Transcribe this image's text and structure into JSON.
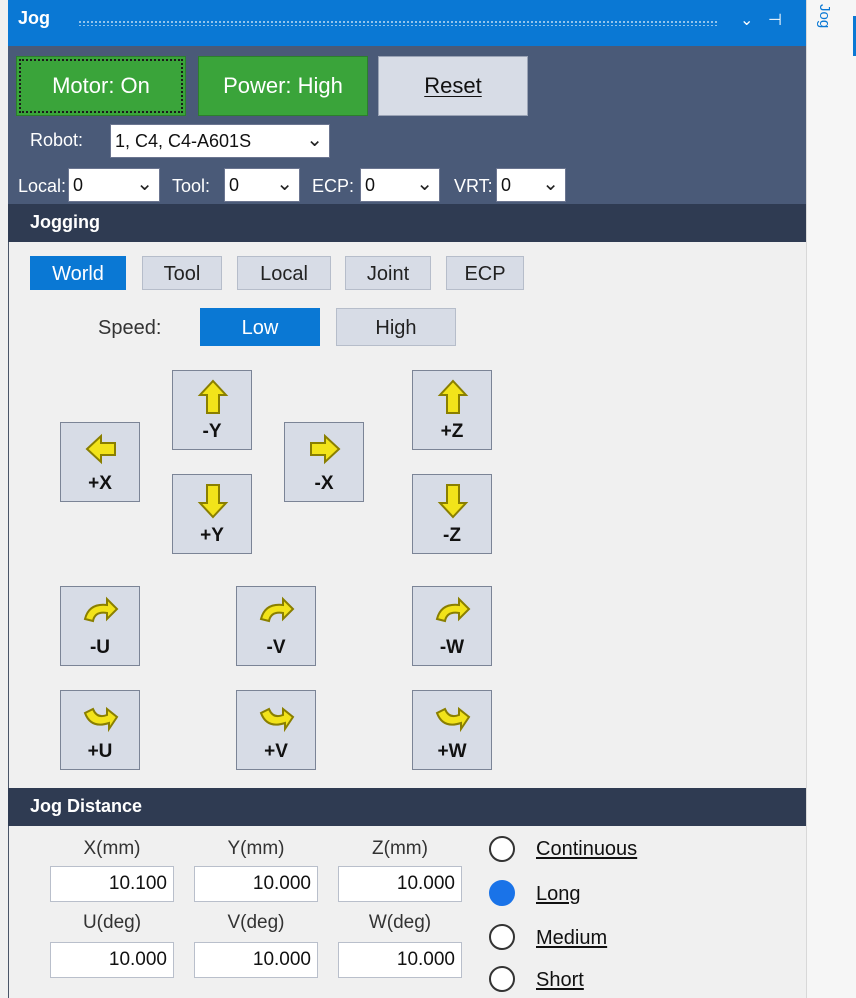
{
  "window": {
    "title": "Jog"
  },
  "side_tab": {
    "label": "Jog"
  },
  "top": {
    "motor_label": "Motor: On",
    "power_label": "Power: High",
    "reset_label": "Reset",
    "robot_label": "Robot:",
    "robot_value": "1, C4, C4-A601S",
    "local_label": "Local:",
    "local_value": "0",
    "tool_label": "Tool:",
    "tool_value": "0",
    "ecp_label": "ECP:",
    "ecp_value": "0",
    "vrt_label": "VRT:",
    "vrt_value": "0"
  },
  "jogging": {
    "header": "Jogging",
    "modes": [
      "World",
      "Tool",
      "Local",
      "Joint",
      "ECP"
    ],
    "active_mode": "World",
    "speed_label": "Speed:",
    "speed_options": [
      "Low",
      "High"
    ],
    "active_speed": "Low",
    "buttons": {
      "plus_x": "+X",
      "minus_x": "-X",
      "minus_y": "-Y",
      "plus_y": "+Y",
      "plus_z": "+Z",
      "minus_z": "-Z",
      "minus_u": "-U",
      "minus_v": "-V",
      "minus_w": "-W",
      "plus_u": "+U",
      "plus_v": "+V",
      "plus_w": "+W"
    }
  },
  "distance": {
    "header": "Jog Distance",
    "labels": [
      "X(mm)",
      "Y(mm)",
      "Z(mm)",
      "U(deg)",
      "V(deg)",
      "W(deg)"
    ],
    "values": [
      "10.100",
      "10.000",
      "10.000",
      "10.000",
      "10.000",
      "10.000"
    ],
    "modes": [
      "Continuous",
      "Long",
      "Medium",
      "Short"
    ],
    "selected_mode": "Long"
  },
  "colors": {
    "accent": "#0a78d4",
    "green": "#3aa43a",
    "header_dark": "#2f3b52",
    "top_band": "#4a5a78",
    "arrow_yellow": "#f2e31a"
  }
}
